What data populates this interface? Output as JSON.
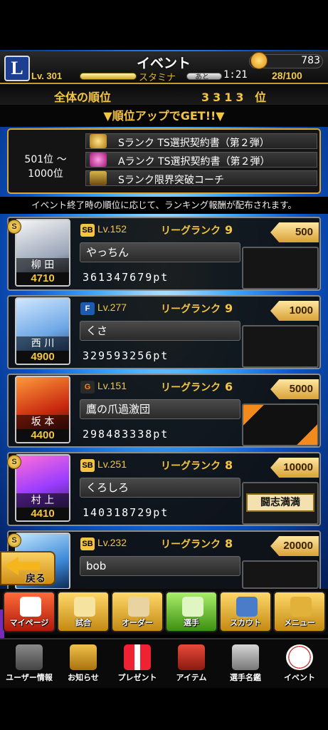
{
  "header": {
    "title": "イベント",
    "logo": "L",
    "coins": "783",
    "level": "Lv. 301",
    "stamina_label": "スタミナ",
    "ato_label": "あと",
    "timer": "1:21",
    "stamina": "28/100"
  },
  "ranking": {
    "label": "全体の順位",
    "value": "3313 位"
  },
  "getup": "▼順位アップでGET!!▼",
  "rewards": {
    "range": [
      "501位 〜",
      "1000位"
    ],
    "items": [
      "Sランク TS選択契約書（第２弾）",
      "Aランク TS選択契約書（第２弾）",
      "Sランク限界突破コーチ"
    ]
  },
  "notice": "イベント終了時の順位に応じて、ランキング報酬が配布されます。",
  "players": [
    {
      "name": "柳 田",
      "score": "4710",
      "team": "SB",
      "lv": "Lv.152",
      "league": "リーグランク",
      "league_num": "9",
      "user": "やっちん",
      "pts": "361347679pt",
      "rank": "500"
    },
    {
      "name": "西 川",
      "score": "4900",
      "team": "F",
      "lv": "Lv.277",
      "league": "リーグランク",
      "league_num": "9",
      "user": "くさ",
      "pts": "329593256pt",
      "rank": "1000"
    },
    {
      "name": "坂 本",
      "score": "4400",
      "team": "G",
      "lv": "Lv.151",
      "league": "リーグランク",
      "league_num": "6",
      "user": "鷹の爪過激団",
      "pts": "298483338pt",
      "rank": "5000"
    },
    {
      "name": "村 上",
      "score": "4410",
      "team": "SB",
      "lv": "Lv.251",
      "league": "リーグランク",
      "league_num": "8",
      "user": "くろしろ",
      "pts": "140318729pt",
      "rank": "10000",
      "plate": "闘志満満"
    },
    {
      "name": "",
      "score": "",
      "team": "SB",
      "lv": "Lv.232",
      "league": "リーグランク",
      "league_num": "8",
      "user": "bob",
      "pts": "",
      "rank": "20000"
    }
  ],
  "back": "戻る",
  "nav1": [
    "マイページ",
    "試合",
    "オーダー",
    "選手",
    "スカウト",
    "メニュー"
  ],
  "nav2": [
    "ユーザー情報",
    "お知らせ",
    "プレゼント",
    "アイテム",
    "選手名鑑",
    "イベント"
  ],
  "colors": {
    "gold": "#f4c542",
    "accent_blue": "#0b55c9"
  }
}
